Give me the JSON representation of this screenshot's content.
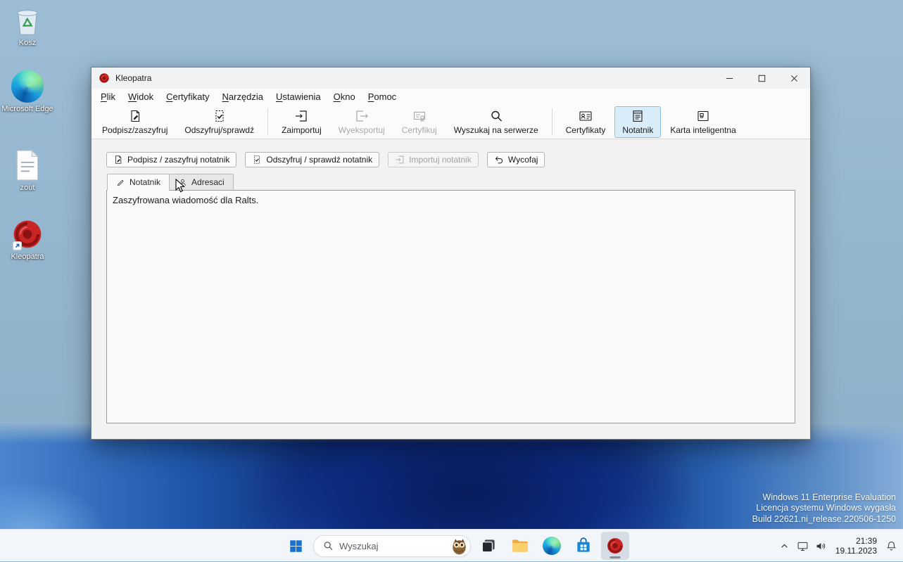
{
  "desktop": {
    "icons": [
      {
        "label": "Kosz"
      },
      {
        "label": "Microsoft Edge"
      },
      {
        "label": "zout"
      },
      {
        "label": "Kleopatra"
      }
    ],
    "watermark": [
      "Windows 11 Enterprise Evaluation",
      "Licencja systemu Windows wygasła",
      "Build 22621.ni_release.220506-1250"
    ]
  },
  "window": {
    "title": "Kleopatra",
    "menu": [
      "Plik",
      "Widok",
      "Certyfikaty",
      "Narzędzia",
      "Ustawienia",
      "Okno",
      "Pomoc"
    ],
    "toolbar": [
      {
        "label": "Podpisz/zaszyfruj",
        "state": "enabled"
      },
      {
        "label": "Odszyfruj/sprawdź",
        "state": "enabled"
      },
      {
        "label": "Zaimportuj",
        "state": "enabled"
      },
      {
        "label": "Wyeksportuj",
        "state": "disabled"
      },
      {
        "label": "Certyfikuj",
        "state": "disabled"
      },
      {
        "label": "Wyszukaj na serwerze",
        "state": "enabled"
      },
      {
        "label": "Certyfikaty",
        "state": "enabled"
      },
      {
        "label": "Notatnik",
        "state": "active"
      },
      {
        "label": "Karta inteligentna",
        "state": "enabled"
      }
    ],
    "notepad_buttons": [
      {
        "label": "Podpisz / zaszyfruj notatnik",
        "state": "enabled"
      },
      {
        "label": "Odszyfruj / sprawdź notatnik",
        "state": "enabled"
      },
      {
        "label": "Importuj notatnik",
        "state": "disabled"
      },
      {
        "label": "Wycofaj",
        "state": "enabled"
      }
    ],
    "tabs": [
      {
        "label": "Notatnik",
        "active": true
      },
      {
        "label": "Adresaci",
        "active": false
      }
    ],
    "editor_text": "Zaszyfrowana wiadomość dla Ralts."
  },
  "taskbar": {
    "search_placeholder": "Wyszukaj",
    "clock_time": "21:39",
    "clock_date": "19.11.2023"
  },
  "colors": {
    "accent_blue": "#0b74d1",
    "active_tool_bg": "#d9ecfa",
    "kleopatra_red": "#c92525",
    "bloom_navy": "#0a1f5e"
  }
}
